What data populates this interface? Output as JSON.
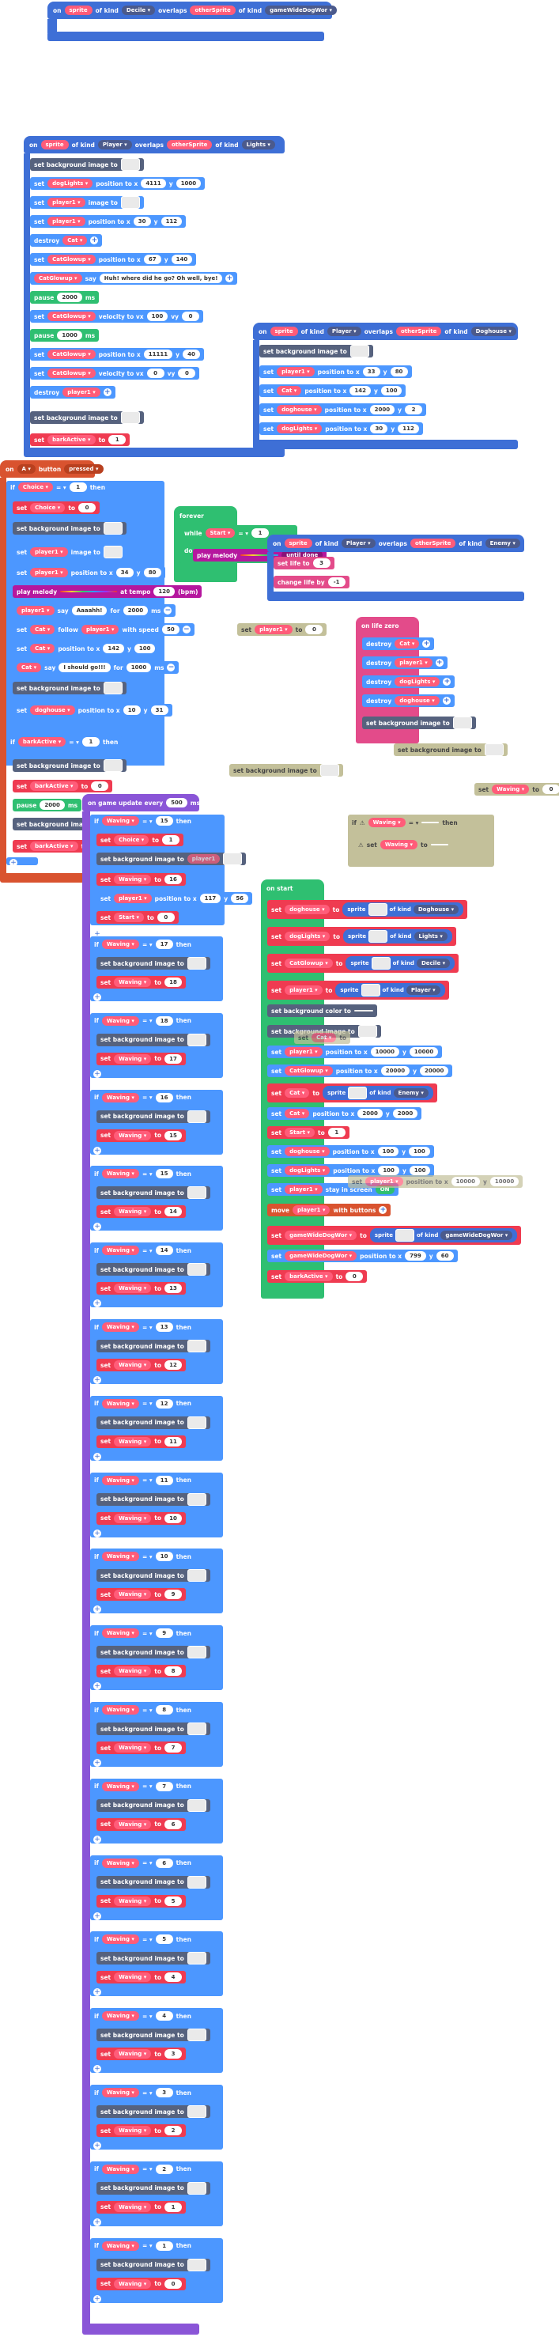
{
  "overlap_top": {
    "on": "on",
    "sprite": "sprite",
    "of_kind": "of kind",
    "kind1": "Decile",
    "overlaps": "overlaps",
    "other": "otherSprite",
    "kind2": "gameWideDogWor"
  },
  "overlap_lights": {
    "header": {
      "on": "on",
      "sprite": "sprite",
      "of_kind": "of kind",
      "kind1": "Player",
      "overlaps": "overlaps",
      "other": "otherSprite",
      "kind2": "Lights"
    },
    "rows": [
      {
        "label": "set background image to"
      },
      {
        "label": "set",
        "var": "dogLights",
        "mid": "position to x",
        "x": "4111",
        "y": "1000"
      },
      {
        "label": "set",
        "var": "player1",
        "mid": "image to"
      },
      {
        "label": "set",
        "var": "player1",
        "mid": "position to x",
        "x": "30",
        "y": "112"
      },
      {
        "label": "destroy",
        "var": "Cat"
      },
      {
        "label": "set",
        "var": "CatGlowup",
        "mid": "position to x",
        "x": "67",
        "y": "140"
      },
      {
        "label": "",
        "var": "CatGlowup",
        "mid": "say",
        "text": "Huh! where did he go? Oh well, bye!"
      },
      {
        "label": "pause",
        "ms": "2000",
        "unit": "ms"
      },
      {
        "label": "set",
        "var": "CatGlowup",
        "mid": "velocity to vx",
        "x": "100",
        "y": "0"
      },
      {
        "label": "pause",
        "ms": "1000",
        "unit": "ms"
      },
      {
        "label": "set",
        "var": "CatGlowup",
        "mid": "position to x",
        "x": "11111",
        "y": "40"
      },
      {
        "label": "set",
        "var": "CatGlowup",
        "mid": "velocity to vx",
        "x": "0",
        "y": "0"
      },
      {
        "label": "destroy",
        "var": "player1"
      },
      {
        "label": "set background image to"
      },
      {
        "label": "set",
        "var": "barkActive",
        "mid": "to",
        "x": "1"
      }
    ]
  },
  "overlap_doghouse": {
    "header": {
      "on": "on",
      "sprite": "sprite",
      "of_kind": "of kind",
      "kind1": "Player",
      "overlaps": "overlaps",
      "other": "otherSprite",
      "kind2": "Doghouse"
    },
    "rows": [
      {
        "label": "set background image to"
      },
      {
        "label": "set",
        "var": "player1",
        "mid": "position to x",
        "x": "33",
        "y": "80"
      },
      {
        "label": "set",
        "var": "Cat",
        "mid": "position to x",
        "x": "142",
        "y": "100"
      },
      {
        "label": "set",
        "var": "doghouse",
        "mid": "position to x",
        "x": "2000",
        "y": "2"
      },
      {
        "label": "set",
        "var": "dogLights",
        "mid": "position to x",
        "x": "30",
        "y": "112"
      }
    ]
  },
  "button_a": {
    "header": {
      "on": "on",
      "btn": "A",
      "button": "button",
      "event": "pressed"
    },
    "rows": [
      {
        "label": "if",
        "var": "Choice",
        "op": "= ▾",
        "val": "1",
        "then": "then"
      },
      {
        "label": "set",
        "var": "Choice",
        "mid": "to",
        "x": "0"
      },
      {
        "label": "set background image to"
      },
      {
        "label": "set",
        "var": "player1",
        "mid": "image to"
      },
      {
        "label": "set",
        "var": "player1",
        "mid": "position to x",
        "x": "34",
        "y": "80"
      },
      {
        "label": "play melody",
        "mid": "at tempo",
        "x": "120",
        "unit": "(bpm)"
      },
      {
        "label": "",
        "var": "player1",
        "mid": "say",
        "text": "Aaaahh!",
        "x": "2000",
        "unit": "ms"
      },
      {
        "label": "set",
        "var": "Cat",
        "mid": "follow",
        "var2": "player1",
        "mid2": "with speed",
        "x": "50"
      },
      {
        "label": "set",
        "var": "Cat",
        "mid": "position to x",
        "x": "142",
        "y": "100"
      },
      {
        "label": "",
        "var": "Cat",
        "mid": "say",
        "text": "I should go!!!",
        "x": "1000",
        "unit": "ms"
      },
      {
        "label": "set background image to"
      },
      {
        "label": "set",
        "var": "doghouse",
        "mid": "position to x",
        "x": "10",
        "y": "31"
      },
      {
        "label": "if",
        "var": "barkActive",
        "op": "= ▾",
        "val": "1",
        "then": "then"
      },
      {
        "label": "set background image to"
      },
      {
        "label": "set",
        "var": "barkActive",
        "mid": "to",
        "x": "0"
      },
      {
        "label": "pause",
        "ms": "2000",
        "unit": "ms"
      },
      {
        "label": "set background image to"
      },
      {
        "label": "set",
        "var": "barkActive",
        "mid": "to",
        "x": "1"
      }
    ]
  },
  "forever": {
    "label": "forever",
    "while": "while",
    "var": "Start",
    "op": "= ▾",
    "val": "1",
    "do": "do",
    "melody": "play melody",
    "until": "until done"
  },
  "overlap_enemy": {
    "header": {
      "on": "on",
      "sprite": "sprite",
      "of_kind": "of kind",
      "kind1": "Player",
      "overlaps": "overlaps",
      "other": "otherSprite",
      "kind2": "Enemy"
    },
    "rows": [
      {
        "label": "set life to",
        "x": "3"
      },
      {
        "label": "change life by",
        "x": "-1"
      }
    ]
  },
  "floating": {
    "set_player": "set",
    "set_player_var": "player1",
    "set_player_to": "to",
    "set_player_val": "0",
    "on_life_zero": "on life zero",
    "destroy": "destroy",
    "destroy_vars": [
      "Cat",
      "player1",
      "dogLights",
      "doghouse"
    ],
    "set_bg": "set background image to",
    "set_waving": "set",
    "waving_var": "Waving",
    "waving_to": "to",
    "waving_val": "0",
    "if": "if",
    "then": "then",
    "warn": "⚠"
  },
  "game_update": {
    "header": {
      "on": "on game update every",
      "ms": "500",
      "unit": "ms"
    },
    "waving_var": "Waving",
    "op": "= ▾",
    "then": "then",
    "if": "if",
    "set": "set",
    "to": "to",
    "set_bg": "set background image to",
    "first": {
      "check": "15",
      "choice_var": "Choice",
      "choice_val": "1",
      "bg": "player1",
      "wave_val": "16",
      "pos_var": "player1",
      "pos_x": "117",
      "pos_y": "56",
      "start_var": "Start",
      "start_val": "0"
    },
    "steps": [
      {
        "check": "17",
        "next": "18"
      },
      {
        "check": "18",
        "next": "17"
      },
      {
        "check": "16",
        "next": "15"
      },
      {
        "check": "15",
        "next": "14"
      },
      {
        "check": "14",
        "next": "13"
      },
      {
        "check": "13",
        "next": "12"
      },
      {
        "check": "12",
        "next": "11"
      },
      {
        "check": "11",
        "next": "10"
      },
      {
        "check": "10",
        "next": "9"
      },
      {
        "check": "9",
        "next": "8"
      },
      {
        "check": "8",
        "next": "7"
      },
      {
        "check": "7",
        "next": "6"
      },
      {
        "check": "6",
        "next": "5"
      },
      {
        "check": "5",
        "next": "4"
      },
      {
        "check": "4",
        "next": "3"
      },
      {
        "check": "3",
        "next": "2"
      },
      {
        "check": "2",
        "next": "1"
      },
      {
        "check": "1",
        "next": "0"
      }
    ]
  },
  "on_start": {
    "label": "on start",
    "rows": [
      {
        "label": "set",
        "var": "doghouse",
        "to": "to",
        "sprite": "sprite",
        "kind_label": "of kind",
        "kind": "Doghouse"
      },
      {
        "label": "set",
        "var": "dogLights",
        "to": "to",
        "sprite": "sprite",
        "kind_label": "of kind",
        "kind": "Lights"
      },
      {
        "label": "set",
        "var": "CatGlowup",
        "to": "to",
        "sprite": "sprite",
        "kind_label": "of kind",
        "kind": "Decile"
      },
      {
        "label": "set",
        "var": "player1",
        "to": "to",
        "sprite": "sprite",
        "kind_label": "of kind",
        "kind": "Player"
      },
      {
        "label": "set background color to"
      },
      {
        "label": "set background image to"
      },
      {
        "label": "set",
        "var": "player1",
        "mid": "position to x",
        "x": "10000",
        "y": "10000"
      },
      {
        "label": "set",
        "var": "CatGlowup",
        "mid": "position to x",
        "x": "20000",
        "y": "20000"
      },
      {
        "label": "set",
        "var": "Cat",
        "to": "to",
        "sprite": "sprite",
        "kind_label": "of kind",
        "kind": "Enemy"
      },
      {
        "label": "set",
        "var": "Cat",
        "mid": "position to x",
        "x": "2000",
        "y": "2000"
      },
      {
        "label": "set",
        "var": "Start",
        "mid": "to",
        "x": "1"
      },
      {
        "label": "set",
        "var": "doghouse",
        "mid": "position to x",
        "x": "100",
        "y": "100"
      },
      {
        "label": "set",
        "var": "dogLights",
        "mid": "position to x",
        "x": "100",
        "y": "100"
      },
      {
        "label": "set",
        "var": "player1",
        "mid": "stay in screen",
        "toggle": "ON"
      },
      {
        "label": "move",
        "var": "player1",
        "mid": "with buttons"
      },
      {
        "label": "set",
        "var": "gameWideDogWor",
        "to": "to",
        "sprite": "sprite",
        "kind_label": "of kind",
        "kind": "gameWideDogWor"
      },
      {
        "label": "set",
        "var": "gameWideDogWor",
        "mid": "position to x",
        "x": "799",
        "y": "60"
      },
      {
        "label": "set",
        "var": "barkActive",
        "mid": "to",
        "x": "0"
      }
    ],
    "ghost_cat": "Cat",
    "ghost_player": "player1",
    "ghost_x": "10000",
    "ghost_y": "10000"
  }
}
